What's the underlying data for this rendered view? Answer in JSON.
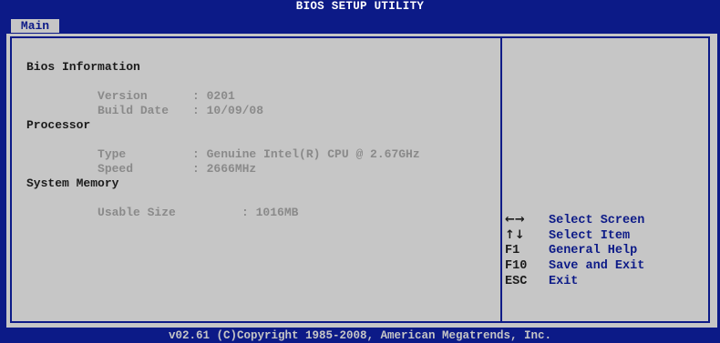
{
  "window": {
    "title": "BIOS SETUP UTILITY"
  },
  "tabs": [
    {
      "label": "Main",
      "active": true
    }
  ],
  "bios_information": {
    "heading": "Bios Information",
    "version_label": "Version",
    "version_value": ": 0201",
    "build_date_label": "Build Date",
    "build_date_value": ": 10/09/08"
  },
  "processor": {
    "heading": "Processor",
    "type_label": "Type",
    "type_value": ": Genuine Intel(R) CPU @ 2.67GHz",
    "speed_label": "Speed",
    "speed_value": ": 2666MHz"
  },
  "system_memory": {
    "heading": "System Memory",
    "usable_size_label": "Usable Size",
    "usable_size_value": ": 1016MB"
  },
  "help": [
    {
      "key": "←→",
      "description": "Select Screen"
    },
    {
      "key": "↑↓",
      "description": "Select Item"
    },
    {
      "key": "F1",
      "description": "General Help"
    },
    {
      "key": "F10",
      "description": "Save and Exit"
    },
    {
      "key": "ESC",
      "description": "Exit"
    }
  ],
  "footer": {
    "copyright": "v02.61 (C)Copyright 1985-2008, American Megatrends, Inc."
  },
  "colors": {
    "background": "#0c1a87",
    "panel": "#c6c6c6",
    "heading_text": "#1b1b1b",
    "value_text": "#8a8a8a",
    "help_text": "#0c1a87"
  }
}
